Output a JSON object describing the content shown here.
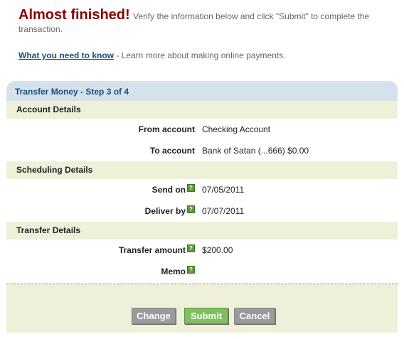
{
  "intro": {
    "headline": "Almost finished!",
    "text": "Verify the information below and click \"Submit\" to complete the transaction."
  },
  "help": {
    "link_label": "What you need to know",
    "text": " - Learn more about making online payments."
  },
  "panel": {
    "title": "Transfer Money - Step 3 of 4"
  },
  "sections": {
    "account": {
      "title": "Account Details",
      "from_label": "From account",
      "from_value": "Checking Account",
      "to_label": "To account",
      "to_value": "Bank of Satan (...666) $0.00"
    },
    "scheduling": {
      "title": "Scheduling Details",
      "send_label": "Send on",
      "send_value": "07/05/2011",
      "deliver_label": "Deliver by",
      "deliver_value": "07/07/2011"
    },
    "transfer": {
      "title": "Transfer Details",
      "amount_label": "Transfer amount",
      "amount_value": "$200.00",
      "memo_label": "Memo",
      "memo_value": ""
    }
  },
  "help_icon_glyph": "?",
  "buttons": {
    "change": "Change",
    "submit": "Submit",
    "cancel": "Cancel"
  },
  "colors": {
    "headline": "#8b0000",
    "panel_header_bg": "#d6e1ec",
    "section_bg": "#eef0da",
    "submit_bg": "#7fbf5f",
    "button_bg": "#9a9a9a",
    "help_icon": "#5a9a3a"
  }
}
